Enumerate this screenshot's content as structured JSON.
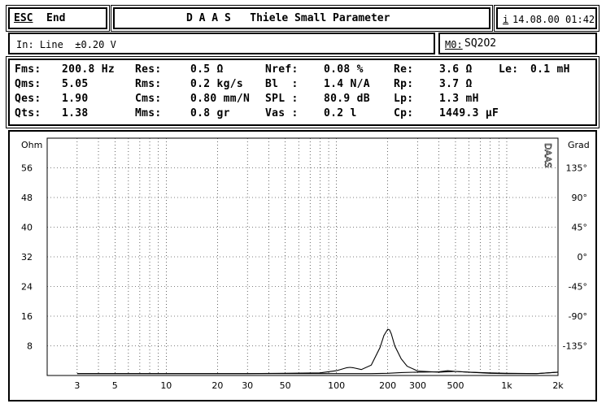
{
  "header": {
    "esc_key": "ESC",
    "end_label": "End",
    "title": "D A A S   Thiele Small Parameter",
    "info_key": "i",
    "datetime": "14.08.00 01:42"
  },
  "input": {
    "label": "In: Line  ±0.20 V",
    "memory_key": "M0:",
    "memory_value": "SQ2O2"
  },
  "params": [
    [
      {
        "k": "Fms:",
        "v": "200.8 Hz"
      },
      {
        "k": "Res:",
        "v": "0.5 Ω"
      },
      {
        "k": "Nref:",
        "v": "0.08 %"
      },
      {
        "k": "Re:",
        "v": "3.6 Ω"
      },
      {
        "k": "Le:",
        "v": "0.1 mH"
      }
    ],
    [
      {
        "k": "Qms:",
        "v": "5.05"
      },
      {
        "k": "Rms:",
        "v": "0.2 kg/s"
      },
      {
        "k": "Bl  :",
        "v": "1.4 N/A"
      },
      {
        "k": "Rp:",
        "v": "3.7 Ω"
      },
      {
        "k": "",
        "v": ""
      }
    ],
    [
      {
        "k": "Qes:",
        "v": "1.90"
      },
      {
        "k": "Cms:",
        "v": "0.80 mm/N"
      },
      {
        "k": "SPL :",
        "v": "80.9 dB"
      },
      {
        "k": "Lp:",
        "v": "1.3 mH"
      },
      {
        "k": "",
        "v": ""
      }
    ],
    [
      {
        "k": "Qts:",
        "v": "1.38"
      },
      {
        "k": "Mms:",
        "v": "0.8 gr"
      },
      {
        "k": "Vas :",
        "v": "0.2 l"
      },
      {
        "k": "Cp:",
        "v": "1449.3 µF"
      },
      {
        "k": "",
        "v": ""
      }
    ]
  ],
  "chart_data": {
    "type": "line",
    "x_scale": "log",
    "xlim": [
      2,
      2000
    ],
    "x_ticks": [
      "3",
      "5",
      "10",
      "20",
      "30",
      "50",
      "100",
      "200",
      "300",
      "500",
      "1k",
      "2k"
    ],
    "x_tick_values": [
      3,
      5,
      10,
      20,
      30,
      50,
      100,
      200,
      300,
      500,
      1000,
      2000
    ],
    "y_left_label": "Ohm",
    "y_left_ticks": [
      "56",
      "48",
      "40",
      "32",
      "24",
      "16",
      "8"
    ],
    "y_left_values": [
      56,
      48,
      40,
      32,
      24,
      16,
      8
    ],
    "ylim": [
      0,
      64
    ],
    "y_right_label": "Grad",
    "y_right_ticks": [
      "135°",
      "90°",
      "45°",
      "0°",
      "-45°",
      "-90°",
      "-135°"
    ],
    "y_right_values": [
      135,
      90,
      45,
      0,
      -45,
      -90,
      -135
    ],
    "watermark": "DAAS",
    "grid": true,
    "series": [
      {
        "x": [
          3,
          10,
          30,
          50,
          80,
          100,
          115,
          120,
          125,
          140,
          160,
          180,
          190,
          200,
          205,
          210,
          220,
          240,
          260,
          300,
          400,
          500,
          600,
          800,
          1000,
          1500,
          2000
        ],
        "y": [
          0.5,
          0.5,
          0.5,
          0.6,
          0.7,
          1.3,
          2.1,
          2.2,
          2.1,
          1.6,
          2.8,
          7.5,
          10.8,
          12.5,
          12.3,
          11.2,
          8.0,
          4.5,
          2.5,
          1.2,
          0.9,
          1.1,
          0.9,
          0.6,
          0.5,
          0.5,
          0.9
        ]
      },
      {
        "x": [
          3,
          10,
          30,
          50,
          80,
          100,
          120,
          160,
          200,
          240,
          300,
          400,
          450,
          500,
          600,
          800,
          1000,
          1500,
          2000
        ],
        "y": [
          0.5,
          0.5,
          0.5,
          0.5,
          0.5,
          0.5,
          0.5,
          0.5,
          0.6,
          0.8,
          0.9,
          1.0,
          1.3,
          1.1,
          0.9,
          0.7,
          0.6,
          0.5,
          0.9
        ]
      }
    ]
  }
}
